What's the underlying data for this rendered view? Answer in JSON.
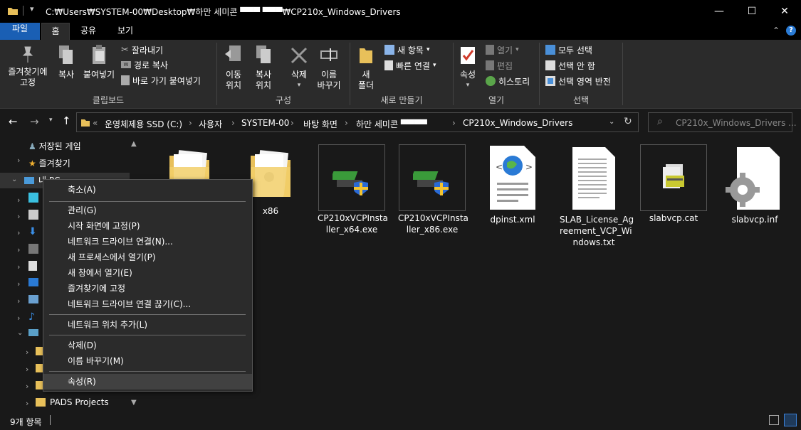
{
  "window": {
    "title": "C:₩Users₩SYSTEM-00₩Desktop₩하만 세미콘 ▀▀▀ ▀▀▀₩CP210x_Windows_Drivers",
    "minimize": "—",
    "maximize": "☐",
    "close": "✕"
  },
  "ribbon_tabs": {
    "file": "파일",
    "home": "홈",
    "share": "공유",
    "view": "보기"
  },
  "ribbon": {
    "clipboard": {
      "pin": "즐겨찾기에\n고정",
      "copy": "복사",
      "paste": "붙여넣기",
      "cut": "잘라내기",
      "copy_path": "경로 복사",
      "paste_shortcut": "바로 가기 붙여넣기",
      "label": "클립보드"
    },
    "organize": {
      "move_to": "이동\n위치",
      "copy_to": "복사\n위치",
      "delete": "삭제",
      "rename": "이름\n바꾸기",
      "label": "구성"
    },
    "new": {
      "new_folder": "새\n폴더",
      "new_item": "새 항목",
      "easy_access": "빠른 연결",
      "label": "새로 만들기"
    },
    "open": {
      "properties": "속성",
      "open": "열기",
      "edit": "편집",
      "history": "히스토리",
      "label": "열기"
    },
    "select": {
      "select_all": "모두 선택",
      "select_none": "선택 안 함",
      "invert": "선택 영역 반전",
      "label": "선택"
    }
  },
  "address": {
    "overflow": "«",
    "crumbs": [
      "운영체제용 SSD (C:)",
      "사용자",
      "SYSTEM-00",
      "바탕 화면",
      "하만 세미콘 ▀▀▀▀",
      "CP210x_Windows_Drivers"
    ],
    "search_placeholder": "CP210x_Windows_Drivers ..."
  },
  "nav": {
    "saved_games": "저장된 게임",
    "favorites": "즐겨찾기",
    "this_pc": "내 PC",
    "pads": "PADS Projects"
  },
  "files": [
    {
      "name": "",
      "type": "folder"
    },
    {
      "name": "x86",
      "type": "folder"
    },
    {
      "name": "CP210xVCPInstaller_x64.exe",
      "type": "installer"
    },
    {
      "name": "CP210xVCPInstaller_x86.exe",
      "type": "installer"
    },
    {
      "name": "dpinst.xml",
      "type": "xml"
    },
    {
      "name": "SLAB_License_Agreement_VCP_Windows.txt",
      "type": "txt"
    },
    {
      "name": "slabvcp.cat",
      "type": "cat"
    },
    {
      "name": "slabvcp.inf",
      "type": "inf"
    }
  ],
  "file_labels": {
    "f1": "x86",
    "f2a": "CP210xVCPInsta",
    "f2b": "ller_x64.exe",
    "f3a": "CP210xVCPInsta",
    "f3b": "ller_x86.exe",
    "f4": "dpinst.xml",
    "f5a": "SLAB_License_Ag",
    "f5b": "reement_VCP_Wi",
    "f5c": "ndows.txt",
    "f6": "slabvcp.cat",
    "f7": "slabvcp.inf"
  },
  "context_menu": {
    "collapse": "축소(A)",
    "manage": "관리(G)",
    "pin_start": "시작 화면에 고정(P)",
    "map_drive": "네트워크 드라이브 연결(N)...",
    "open_new_process": "새 프로세스에서 열기(P)",
    "open_new_window": "새 창에서 열기(E)",
    "pin_quick": "즐겨찾기에 고정",
    "disconnect_drive": "네트워크 드라이브 연결 끊기(C)...",
    "add_network": "네트워크 위치 추가(L)",
    "delete": "삭제(D)",
    "rename": "이름 바꾸기(M)",
    "properties": "속성(R)"
  },
  "status": {
    "count": "9개 항목"
  }
}
